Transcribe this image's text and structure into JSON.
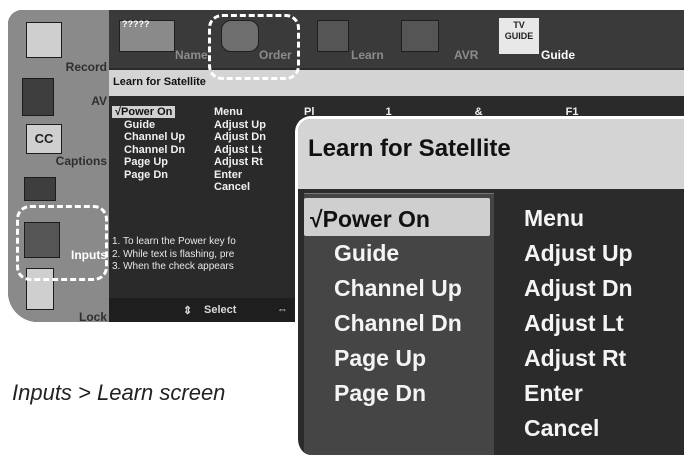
{
  "sidebar": {
    "items": [
      {
        "label": "Record"
      },
      {
        "label": "AV"
      },
      {
        "label": "Captions"
      },
      {
        "label": "Inputs"
      },
      {
        "label": "Lock"
      }
    ]
  },
  "tabs": [
    {
      "label": "Name"
    },
    {
      "label": "Order"
    },
    {
      "label": "Learn"
    },
    {
      "label": "AVR"
    },
    {
      "label": "Guide"
    }
  ],
  "name_tab_icon_text": "?????",
  "tv_guide_logo": "TV GUIDE",
  "screen_title": "Learn for Satellite",
  "checkmark": "√",
  "keys_col1": [
    "Power On",
    "Guide",
    "Channel Up",
    "Channel Dn",
    "Page Up",
    "Page Dn"
  ],
  "keys_col2": [
    "Menu",
    "Adjust Up",
    "Adjust Dn",
    "Adjust Lt",
    "Adjust Rt",
    "Enter",
    "Cancel"
  ],
  "keys_col3_partial": [
    "Pl",
    "1",
    "&",
    "F1"
  ],
  "instructions": [
    "1. To learn the Power key fo",
    "2. While text is flashing, pre",
    "3. When the check appears"
  ],
  "bottom_bar": {
    "select_label": "Select"
  },
  "caption": "Inputs > Learn screen"
}
